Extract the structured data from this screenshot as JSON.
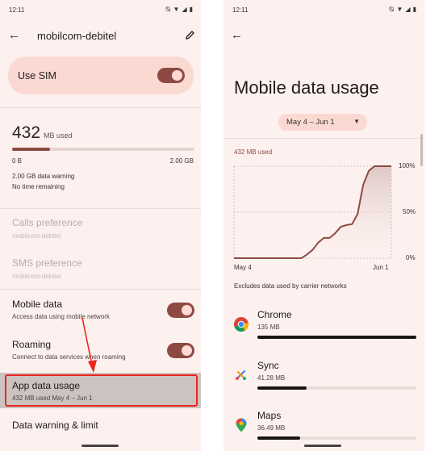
{
  "left_screen": {
    "status": {
      "time": "12:11"
    },
    "title": "mobilcom-debitel",
    "use_sim": {
      "label": "Use SIM",
      "on": true
    },
    "usage": {
      "amount": "432",
      "unit": "MB used",
      "progress_fraction": 0.21,
      "min_label": "0 B",
      "max_label": "2.00 GB",
      "warning": "2.00 GB data warning",
      "remaining": "No time remaining"
    },
    "calls_pref": {
      "title": "Calls preference",
      "sub": "mobilcom-debitel"
    },
    "sms_pref": {
      "title": "SMS preference",
      "sub": "mobilcom-debitel"
    },
    "mobile_data": {
      "title": "Mobile data",
      "sub": "Access data using mobile network",
      "on": true
    },
    "roaming": {
      "title": "Roaming",
      "sub": "Connect to data services when roaming",
      "on": true
    },
    "app_data_usage": {
      "title": "App data usage",
      "sub": "432 MB used May 4 – Jun 1"
    },
    "data_warning": {
      "title": "Data warning & limit"
    },
    "annotation_color": "#e8261f"
  },
  "right_screen": {
    "status": {
      "time": "12:11"
    },
    "title": "Mobile data usage",
    "date_range": "May 4 – Jun 1",
    "used_label": "432 MB used",
    "chart_data": {
      "type": "area",
      "x": [
        0,
        2,
        4,
        6,
        8,
        10,
        12,
        13,
        14,
        15,
        16,
        17,
        18,
        19,
        20,
        21,
        22,
        23,
        24,
        25,
        26,
        28
      ],
      "values": [
        0,
        0,
        0,
        0,
        0,
        0,
        0,
        4,
        9,
        17,
        22,
        22,
        27,
        34,
        36,
        37,
        48,
        80,
        95,
        100,
        100,
        100
      ],
      "x_tick_labels": [
        "May 4",
        "Jun 1"
      ],
      "y_tick_labels": [
        "100%",
        "50%",
        "0%"
      ],
      "ylim": [
        0,
        100
      ],
      "line_color": "#8d4a42"
    },
    "note": "Excludes data used by carrier networks",
    "apps": [
      {
        "name": "Chrome",
        "size": "135 MB",
        "fraction": 1.0
      },
      {
        "name": "Sync",
        "size": "41.28 MB",
        "fraction": 0.31
      },
      {
        "name": "Maps",
        "size": "36.49 MB",
        "fraction": 0.27
      }
    ]
  }
}
